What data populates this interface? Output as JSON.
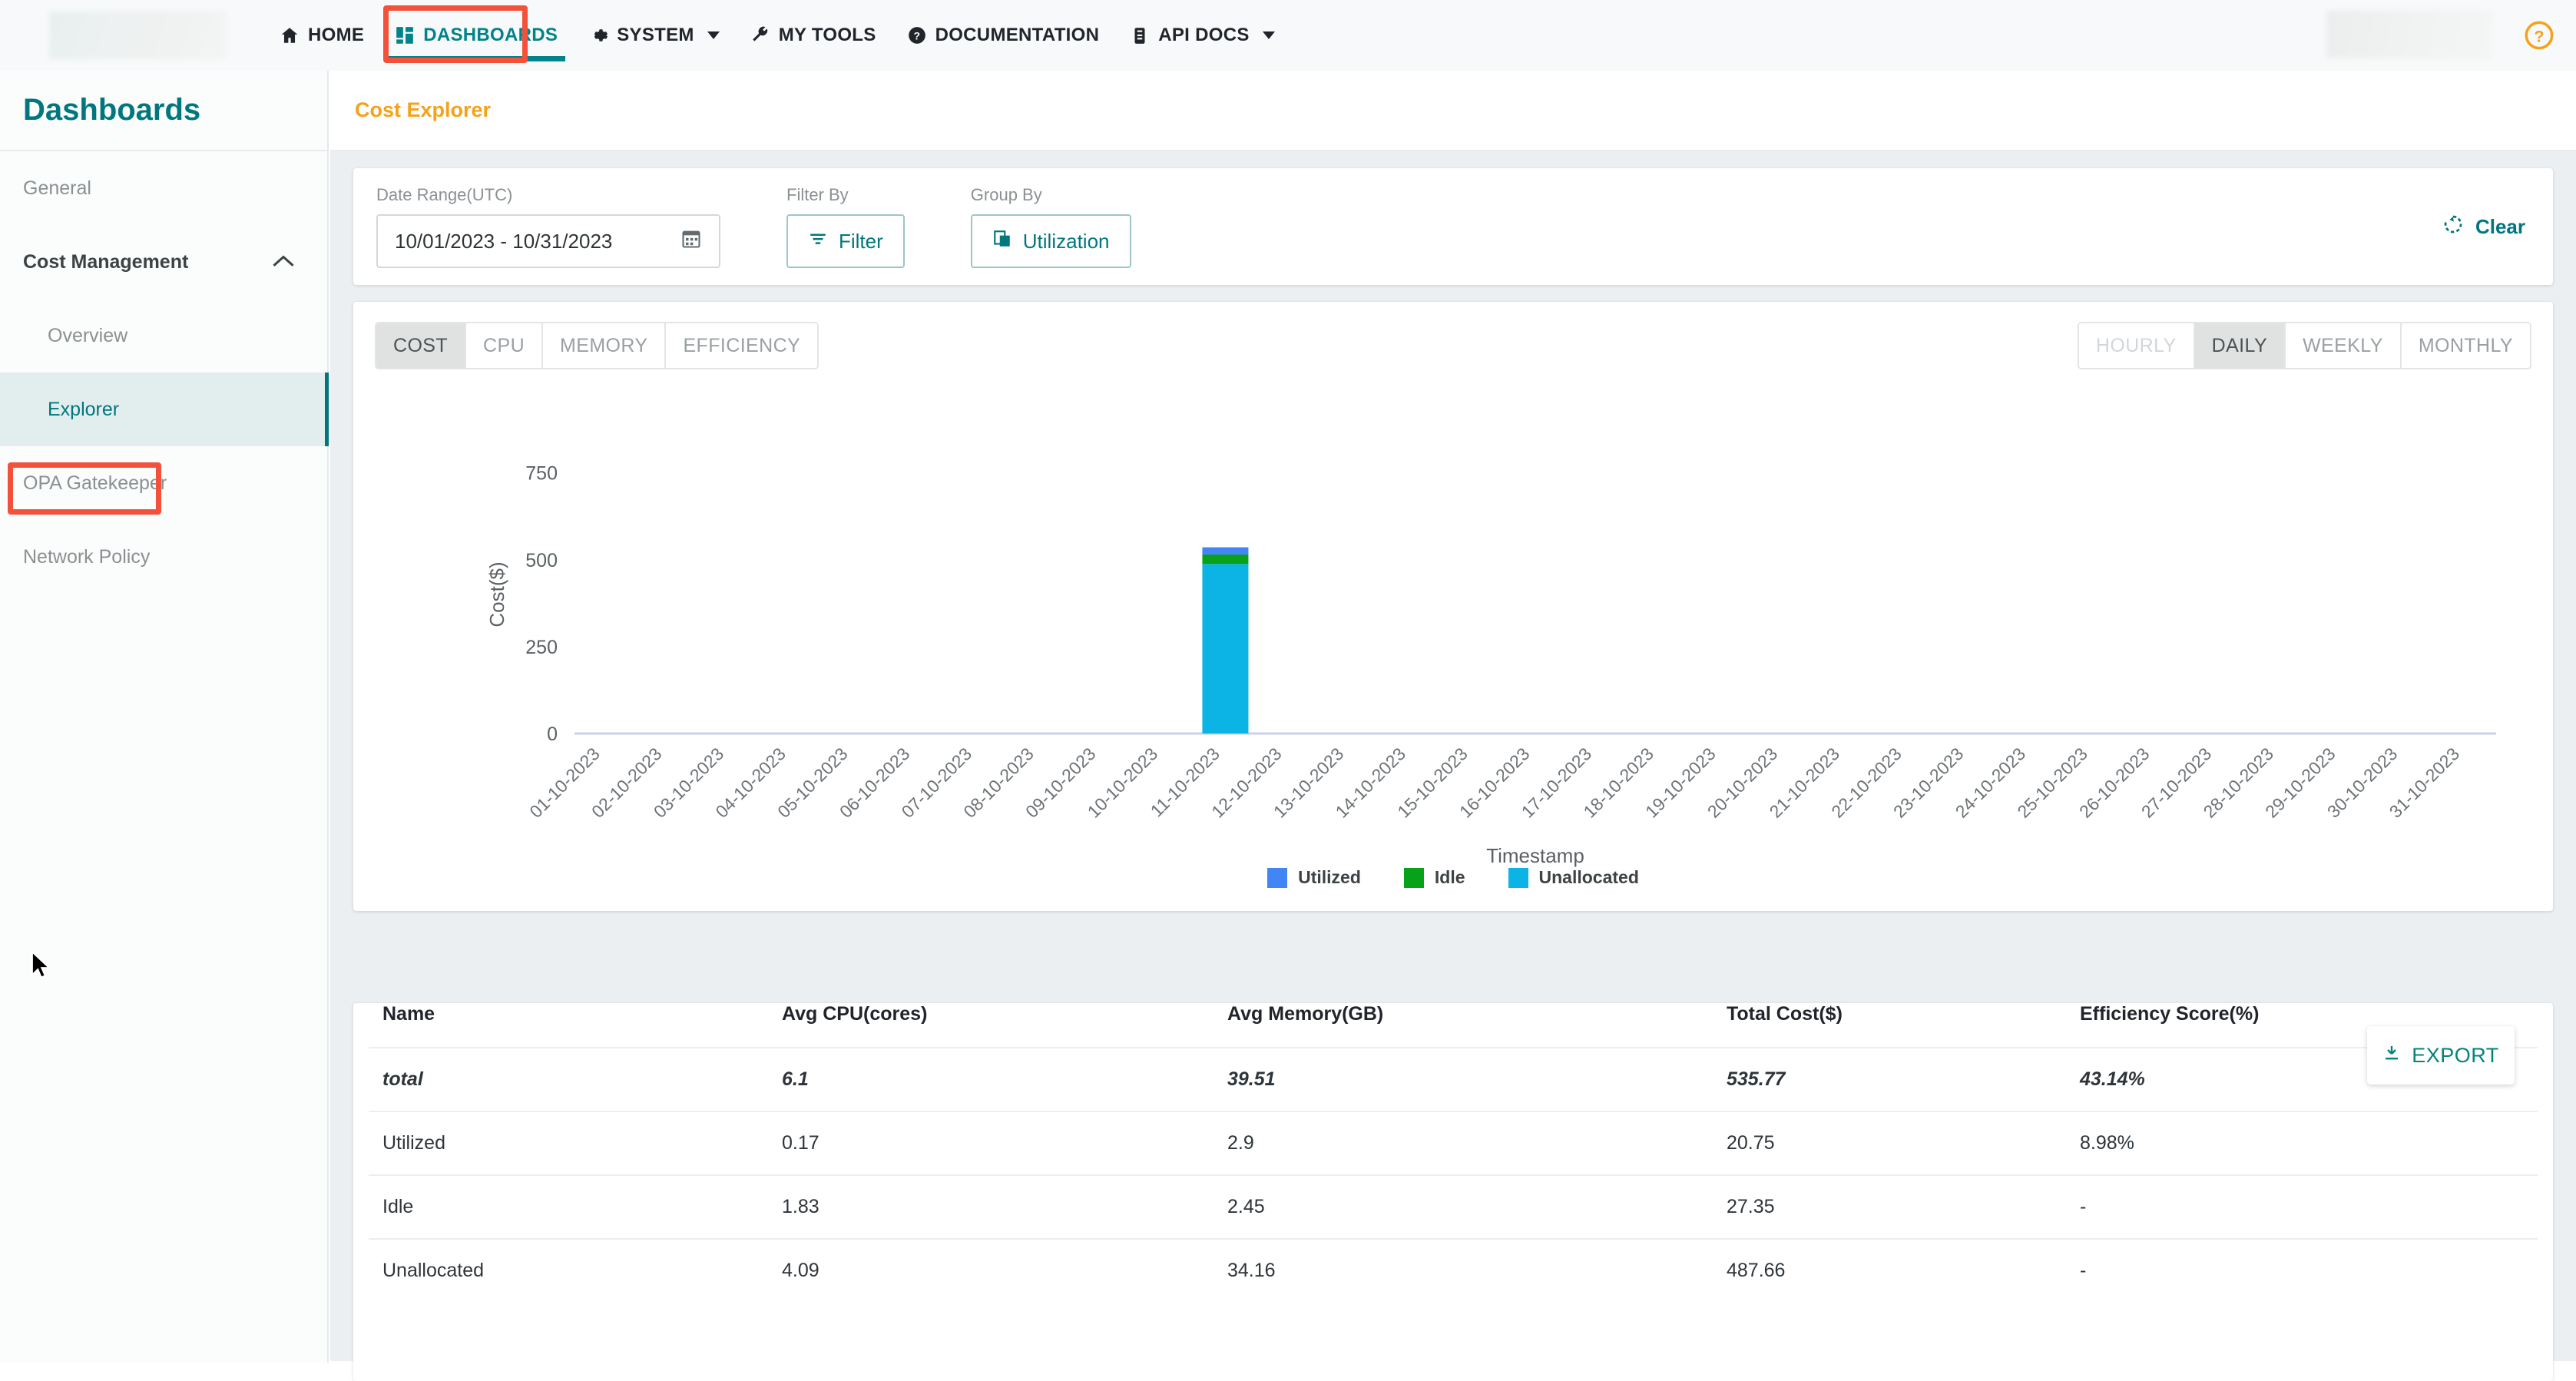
{
  "topnav": {
    "items": [
      {
        "label": "HOME",
        "icon": "home-icon",
        "caret": false,
        "active": false
      },
      {
        "label": "DASHBOARDS",
        "icon": "grid-icon",
        "caret": false,
        "active": true
      },
      {
        "label": "SYSTEM",
        "icon": "gear-icon",
        "caret": true,
        "active": false
      },
      {
        "label": "MY TOOLS",
        "icon": "wrench-icon",
        "caret": false,
        "active": false
      },
      {
        "label": "DOCUMENTATION",
        "icon": "question-circle-icon",
        "caret": false,
        "active": false
      },
      {
        "label": "API DOCS",
        "icon": "clipboard-icon",
        "caret": true,
        "active": false
      }
    ],
    "help_icon": "help-circle-icon",
    "accent": "#00838a",
    "highlight_box_color": "#f4513b"
  },
  "sidebar": {
    "title": "Dashboards",
    "items": [
      {
        "label": "General",
        "level": "top",
        "selected": false,
        "bold": false
      },
      {
        "label": "Cost Management",
        "level": "top",
        "selected": false,
        "bold": true,
        "chevron": "chevron-up-icon"
      },
      {
        "label": "Overview",
        "level": "sub",
        "selected": false,
        "bold": false
      },
      {
        "label": "Explorer",
        "level": "sub",
        "selected": true,
        "bold": false
      },
      {
        "label": "OPA Gatekeeper",
        "level": "top",
        "selected": false,
        "bold": false
      },
      {
        "label": "Network Policy",
        "level": "top",
        "selected": false,
        "bold": false
      }
    ],
    "title_color": "#00777e",
    "selected_bg": "#e2eeee"
  },
  "page": {
    "title": "Cost Explorer",
    "title_color": "#f5a21a"
  },
  "filters": {
    "date_range_label": "Date Range(UTC)",
    "date_range_value": "10/01/2023  -  10/31/2023",
    "calendar_icon": "calendar-icon",
    "filter_by_label": "Filter By",
    "filter_button": "Filter",
    "filter_icon": "filter-icon",
    "group_by_label": "Group By",
    "group_button": "Utilization",
    "group_icon": "copy-layers-icon",
    "clear_label": "Clear",
    "clear_icon": "restore-icon"
  },
  "metric_tabs": {
    "items": [
      "COST",
      "CPU",
      "MEMORY",
      "EFFICIENCY"
    ],
    "selected": "COST"
  },
  "granularity_tabs": {
    "items": [
      "HOURLY",
      "DAILY",
      "WEEKLY",
      "MONTHLY"
    ],
    "selected": "DAILY",
    "disabled": [
      "HOURLY"
    ]
  },
  "chart_data": {
    "type": "bar",
    "stacked": true,
    "title": "",
    "xlabel": "Timestamp",
    "ylabel": "Cost($)",
    "ylim": [
      0,
      800
    ],
    "yticks": [
      0,
      250,
      500,
      750
    ],
    "grid": false,
    "legend_position": "bottom",
    "categories": [
      "01-10-2023",
      "02-10-2023",
      "03-10-2023",
      "04-10-2023",
      "05-10-2023",
      "06-10-2023",
      "07-10-2023",
      "08-10-2023",
      "09-10-2023",
      "10-10-2023",
      "11-10-2023",
      "12-10-2023",
      "13-10-2023",
      "14-10-2023",
      "15-10-2023",
      "16-10-2023",
      "17-10-2023",
      "18-10-2023",
      "19-10-2023",
      "20-10-2023",
      "21-10-2023",
      "22-10-2023",
      "23-10-2023",
      "24-10-2023",
      "25-10-2023",
      "26-10-2023",
      "27-10-2023",
      "28-10-2023",
      "29-10-2023",
      "30-10-2023",
      "31-10-2023"
    ],
    "series": [
      {
        "name": "Unallocated",
        "color": "#0cb4e6",
        "values": [
          0,
          0,
          0,
          0,
          0,
          0,
          0,
          0,
          0,
          0,
          487.66,
          0,
          0,
          0,
          0,
          0,
          0,
          0,
          0,
          0,
          0,
          0,
          0,
          0,
          0,
          0,
          0,
          0,
          0,
          0,
          0
        ]
      },
      {
        "name": "Idle",
        "color": "#08a11a",
        "values": [
          0,
          0,
          0,
          0,
          0,
          0,
          0,
          0,
          0,
          0,
          27.35,
          0,
          0,
          0,
          0,
          0,
          0,
          0,
          0,
          0,
          0,
          0,
          0,
          0,
          0,
          0,
          0,
          0,
          0,
          0,
          0
        ]
      },
      {
        "name": "Utilized",
        "color": "#4285f4",
        "values": [
          0,
          0,
          0,
          0,
          0,
          0,
          0,
          0,
          0,
          0,
          20.75,
          0,
          0,
          0,
          0,
          0,
          0,
          0,
          0,
          0,
          0,
          0,
          0,
          0,
          0,
          0,
          0,
          0,
          0,
          0,
          0
        ]
      }
    ],
    "legend": [
      "Utilized",
      "Idle",
      "Unallocated"
    ]
  },
  "table": {
    "export_label": "EXPORT",
    "export_icon": "download-icon",
    "columns": [
      "Name",
      "Avg CPU(cores)",
      "Avg Memory(GB)",
      "Total Cost($)",
      "Efficiency Score(%)"
    ],
    "rows": [
      {
        "name": "total",
        "cpu": "6.1",
        "memory": "39.51",
        "cost": "535.77",
        "efficiency": "43.14%",
        "is_total": true
      },
      {
        "name": "Utilized",
        "cpu": "0.17",
        "memory": "2.9",
        "cost": "20.75",
        "efficiency": "8.98%",
        "is_total": false
      },
      {
        "name": "Idle",
        "cpu": "1.83",
        "memory": "2.45",
        "cost": "27.35",
        "efficiency": "-",
        "is_total": false
      },
      {
        "name": "Unallocated",
        "cpu": "4.09",
        "memory": "34.16",
        "cost": "487.66",
        "efficiency": "-",
        "is_total": false
      }
    ]
  }
}
